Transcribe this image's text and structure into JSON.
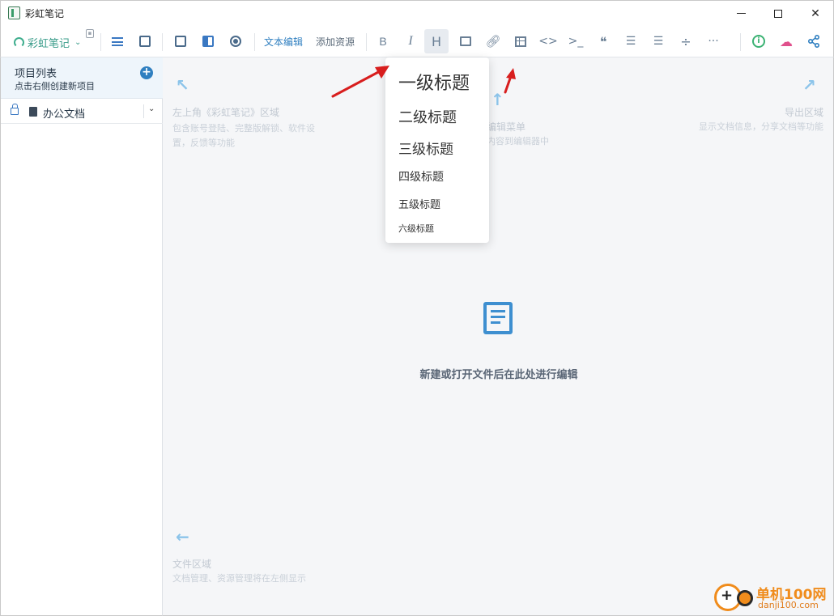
{
  "window": {
    "title": "彩虹笔记"
  },
  "toolbar": {
    "brand_label": "彩虹笔记",
    "text_edit_label": "文本编辑",
    "add_resource_label": "添加资源",
    "bold_glyph": "B",
    "italic_glyph": "I",
    "heading_glyph": "H",
    "code_glyph": "<>",
    "terminal_glyph": ">_",
    "quote_glyph": "❝",
    "divide_glyph": "÷",
    "more_glyph": "···",
    "info_glyph": "i",
    "accent_color": "#2f7fc0"
  },
  "sidebar": {
    "title": "项目列表",
    "subtitle": "点击右侧创建新项目",
    "add_glyph": "+",
    "project_name": "办公文档"
  },
  "main": {
    "hint_top_left_title": "左上角《彩虹笔记》区域",
    "hint_top_left_desc": "包含账号登陆、完整版解锁、软件设置，反馈等功能",
    "hint_top_center_title": "编辑菜单",
    "hint_top_center_desc": "内容到编辑器中",
    "hint_top_right_title": "导出区域",
    "hint_top_right_desc": "显示文档信息，分享文档等功能",
    "hint_bottom_left_title": "文件区域",
    "hint_bottom_left_desc": "文档管理、资源管理将在左侧显示",
    "empty_message": "新建或打开文件后在此处进行编辑"
  },
  "heading_menu": {
    "items": [
      "一级标题",
      "二级标题",
      "三级标题",
      "四级标题",
      "五级标题",
      "六级标题"
    ]
  },
  "watermark": {
    "name": "单机100网",
    "url": "danji100.com"
  }
}
